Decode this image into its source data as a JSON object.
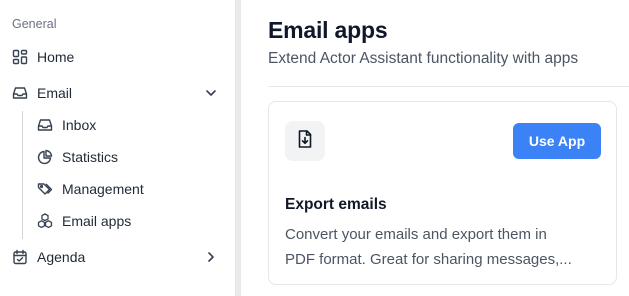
{
  "sidebar": {
    "section_label": "General",
    "items": [
      {
        "label": "Home",
        "icon": "grid-icon"
      },
      {
        "label": "Email",
        "icon": "inbox-tray-icon",
        "expanded": true
      },
      {
        "label": "Agenda",
        "icon": "calendar-check-icon",
        "expanded": false
      }
    ],
    "email_subitems": [
      {
        "label": "Inbox",
        "icon": "inbox-tray-icon"
      },
      {
        "label": "Statistics",
        "icon": "pie-chart-icon"
      },
      {
        "label": "Management",
        "icon": "tags-icon"
      },
      {
        "label": "Email apps",
        "icon": "cubes-icon"
      }
    ]
  },
  "main": {
    "title": "Email apps",
    "subtitle": "Extend Actor Assistant functionality with apps",
    "apps": [
      {
        "title": "Export emails",
        "icon": "file-download-icon",
        "button_label": "Use App",
        "description_line1": "Convert your emails and export them in",
        "description_line2": "PDF format. Great for sharing messages,..."
      }
    ]
  },
  "colors": {
    "accent": "#3b82f6",
    "text_primary": "#111827",
    "text_secondary": "#4b5563",
    "border": "#e5e7eb"
  }
}
